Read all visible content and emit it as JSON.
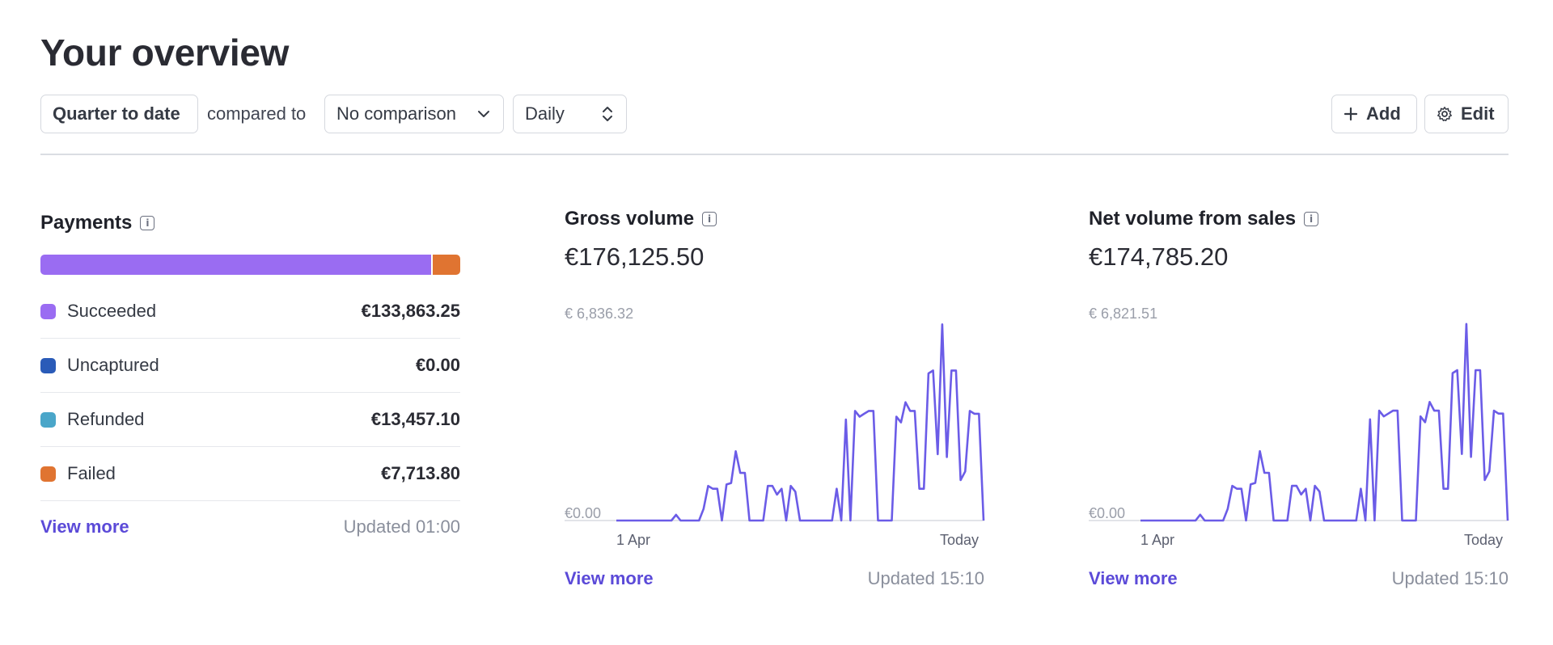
{
  "page": {
    "title": "Your overview"
  },
  "toolbar": {
    "range_label": "Quarter to date",
    "compared_to": "compared to",
    "comparison_label": "No comparison",
    "interval_label": "Daily",
    "add_label": "Add",
    "edit_label": "Edit"
  },
  "payments": {
    "title": "Payments",
    "bar": [
      {
        "name": "Succeeded",
        "share": 0.93
      },
      {
        "name": "Failed",
        "share": 0.07
      }
    ],
    "items": [
      {
        "label": "Succeeded",
        "value": "€133,863.25",
        "color": "#9a6cf2"
      },
      {
        "label": "Uncaptured",
        "value": "€0.00",
        "color": "#2a5bb8"
      },
      {
        "label": "Refunded",
        "value": "€13,457.10",
        "color": "#4aa6c9"
      },
      {
        "label": "Failed",
        "value": "€7,713.80",
        "color": "#e07431"
      }
    ],
    "view_more": "View more",
    "updated": "Updated 01:00"
  },
  "gross": {
    "title": "Gross volume",
    "amount": "€176,125.50",
    "y_max_label": "€ 6,836.32",
    "y_min_label": "€0.00",
    "x_start": "1 Apr",
    "x_end": "Today",
    "view_more": "View more",
    "updated": "Updated 15:10"
  },
  "net": {
    "title": "Net volume from sales",
    "amount": "€174,785.20",
    "y_max_label": "€ 6,821.51",
    "y_min_label": "€0.00",
    "x_start": "1 Apr",
    "x_end": "Today",
    "view_more": "View more",
    "updated": "Updated 15:10"
  },
  "colors": {
    "accent": "#5b4ad8",
    "line": "#6b5ce7"
  },
  "chart_data": [
    {
      "type": "line",
      "title": "Gross volume",
      "ylim": [
        0,
        6836.32
      ],
      "series": [
        {
          "values": [
            0,
            0,
            0,
            0,
            0,
            0,
            0,
            0,
            0,
            0,
            0,
            0,
            0,
            200,
            0,
            0,
            0,
            0,
            0,
            400,
            1200,
            1100,
            1100,
            0,
            1250,
            1300,
            2400,
            1650,
            1650,
            0,
            0,
            0,
            0,
            1200,
            1200,
            900,
            1100,
            0,
            1200,
            1000,
            0,
            0,
            0,
            0,
            0,
            0,
            0,
            0,
            1100,
            0,
            3500,
            0,
            3800,
            3600,
            3700,
            3800,
            3800,
            0,
            0,
            0,
            0,
            3600,
            3400,
            4100,
            3800,
            3800,
            1100,
            1100,
            5100,
            5200,
            2300,
            6800,
            2200,
            5200,
            5200,
            1400,
            1700,
            3800,
            3700,
            3700,
            0
          ]
        }
      ]
    },
    {
      "type": "line",
      "title": "Net volume from sales",
      "ylim": [
        0,
        6821.51
      ],
      "series": [
        {
          "values": [
            0,
            0,
            0,
            0,
            0,
            0,
            0,
            0,
            0,
            0,
            0,
            0,
            0,
            200,
            0,
            0,
            0,
            0,
            0,
            400,
            1200,
            1100,
            1100,
            0,
            1250,
            1300,
            2400,
            1650,
            1650,
            0,
            0,
            0,
            0,
            1200,
            1200,
            900,
            1100,
            0,
            1200,
            1000,
            0,
            0,
            0,
            0,
            0,
            0,
            0,
            0,
            1100,
            0,
            3500,
            0,
            3800,
            3600,
            3700,
            3800,
            3800,
            0,
            0,
            0,
            0,
            3600,
            3400,
            4100,
            3800,
            3800,
            1100,
            1100,
            5100,
            5200,
            2300,
            6800,
            2200,
            5200,
            5200,
            1400,
            1700,
            3800,
            3700,
            3700,
            0
          ]
        }
      ]
    }
  ]
}
